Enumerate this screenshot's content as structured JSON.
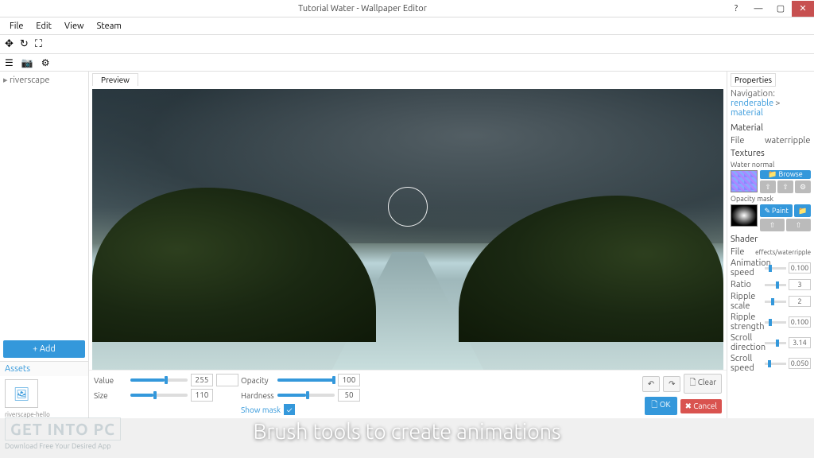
{
  "window": {
    "title": "Tutorial Water - Wallpaper Editor",
    "help": "?",
    "minimize": "—",
    "maximize": "▢",
    "close": "✕"
  },
  "menu": {
    "file": "File",
    "edit": "Edit",
    "view": "View",
    "steam": "Steam"
  },
  "toolbar": {
    "move": "✥",
    "reload": "↻",
    "fullscreen": "⛶"
  },
  "toolbar2": {
    "list": "☰",
    "camera": "📷",
    "gear": "⚙"
  },
  "left": {
    "tree_item": "riverscape",
    "add": "+ Add",
    "assets_tab": "Assets",
    "asset_icon": "🖼",
    "asset_name": "riverscape-hello"
  },
  "preview": {
    "tab": "Preview"
  },
  "brush": {
    "value_label": "Value",
    "value": "255",
    "size_label": "Size",
    "size": "110",
    "opacity_label": "Opacity",
    "opacity": "100",
    "hardness_label": "Hardness",
    "hardness": "50",
    "showmask_label": "Show mask",
    "undo": "↶",
    "redo": "↷",
    "clear": "🗋 Clear",
    "ok": "🗋 OK",
    "cancel": "✖ Cancel"
  },
  "props": {
    "tab": "Properties",
    "nav_prefix": "Navigation:",
    "nav1": "renderable",
    "nav_sep": ">",
    "nav2": "material",
    "material_h": "Material",
    "file_label": "File",
    "file_value": "waterripple",
    "textures_h": "Textures",
    "tex1_label": "Water normal",
    "browse": "📁 Browse",
    "tex2_label": "Opacity mask",
    "paint": "✎ Paint",
    "icon_upload": "⇧",
    "icon_gear": "⚙",
    "icon_folder": "📁",
    "shader_h": "Shader",
    "shader_file_label": "File",
    "shader_file": "effects/waterripple",
    "anim_speed_label": "Animation speed",
    "anim_speed": "0.100",
    "ratio_label": "Ratio",
    "ratio": "3",
    "ripple_scale_label": "Ripple scale",
    "ripple_scale": "2",
    "ripple_strength_label": "Ripple strength",
    "ripple_strength": "0.100",
    "scroll_dir_label": "Scroll direction",
    "scroll_dir": "3.14",
    "scroll_speed_label": "Scroll speed",
    "scroll_speed": "0.050"
  },
  "caption": "Brush tools to create animations",
  "watermark": {
    "line1": "GET INTO PC",
    "line2": "Download Free Your Desired App"
  }
}
